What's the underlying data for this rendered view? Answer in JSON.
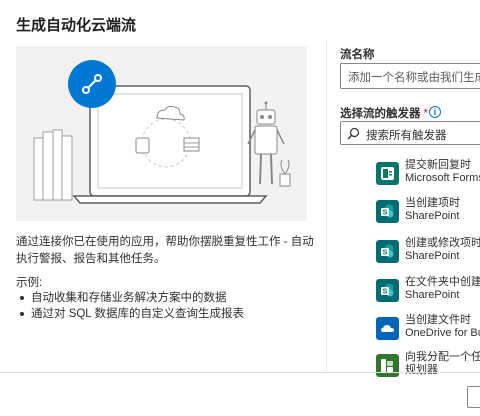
{
  "dialog": {
    "title": "生成自动化云端流",
    "description": "通过连接你已在使用的应用，帮助你摆脱重复性工作 - 自动执行警报、报告和其他任务。",
    "examples_title": "示例:",
    "examples": [
      "自动收集和存储业务解决方案中的数据",
      "通过对 SQL 数据库的自定义查询生成报表"
    ]
  },
  "form": {
    "flow_name_label": "流名称",
    "flow_name_placeholder": "添加一个名称或由我们生成一个",
    "trigger_label": "选择流的触发器",
    "required_mark": "*",
    "info_icon": "i",
    "search_placeholder": "搜索所有触发器"
  },
  "triggers": [
    {
      "name": "提交新回复时",
      "connector": "Microsoft Forms",
      "color": "#077568",
      "icon": "forms-icon"
    },
    {
      "name": "当创建项时",
      "connector": "SharePoint",
      "color": "#036c70",
      "icon": "sharepoint-icon"
    },
    {
      "name": "创建或修改项时",
      "connector": "SharePoint",
      "color": "#036c70",
      "icon": "sharepoint-icon"
    },
    {
      "name": "在文件夹中创建文",
      "connector": "SharePoint",
      "color": "#036c70",
      "icon": "sharepoint-icon"
    },
    {
      "name": "当创建文件时",
      "connector": "OneDrive for Busi",
      "color": "#0364b8",
      "icon": "onedrive-icon"
    },
    {
      "name": "向我分配一个任务",
      "connector": "规划器",
      "color": "#31752f",
      "icon": "planner-icon"
    }
  ],
  "colors": {
    "accent": "#0078d4",
    "hero_bg": "#f3f2f1"
  }
}
